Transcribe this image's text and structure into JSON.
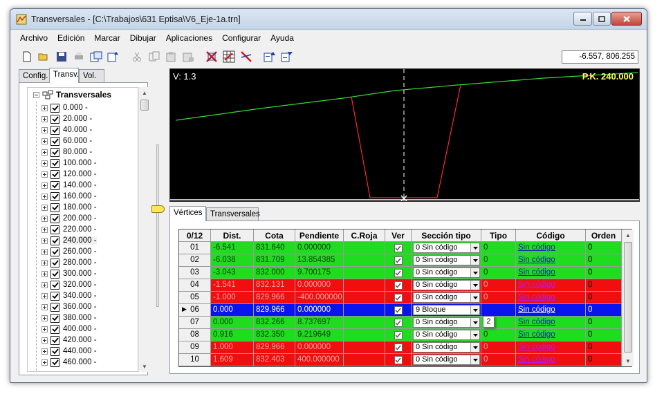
{
  "window": {
    "title": "Transversales - [C:\\Trabajos\\631 Eptisa\\V6_Eje-1a.trn]"
  },
  "menu": [
    "Archivo",
    "Edición",
    "Marcar",
    "Dibujar",
    "Aplicaciones",
    "Configurar",
    "Ayuda"
  ],
  "toolbar": {
    "icons": [
      "new-file-icon",
      "open-folder-icon",
      "save-icon",
      "print-icon",
      "copy-section-icon",
      "paste-section-icon",
      "cut-icon",
      "copy-icon",
      "paste-icon",
      "paste-special-icon",
      "delete-sections-icon",
      "grid-section-icon",
      "no-section-icon",
      "export-icon",
      "import-icon"
    ],
    "coordinates": "-6.557, 806.255"
  },
  "left_tabs": [
    "Config.",
    "Transv.",
    "Vol."
  ],
  "left_tabs_active": 1,
  "tree": {
    "root": "Transversales",
    "items": [
      "0.000 -",
      "20.000 -",
      "40.000 -",
      "60.000 -",
      "80.000 -",
      "100.000 -",
      "120.000 -",
      "140.000 -",
      "160.000 -",
      "180.000 -",
      "200.000 -",
      "220.000 -",
      "240.000 -",
      "260.000 -",
      "280.000 -",
      "300.000 -",
      "320.000 -",
      "340.000 -",
      "360.000 -",
      "380.000 -",
      "400.000 -",
      "420.000 -",
      "440.000 -",
      "460.000 -"
    ],
    "selected_index": 12
  },
  "canvas": {
    "v_label": "V: 1.3",
    "pk_label": "P.K. 240.000",
    "colors": {
      "background": "#000000",
      "terrain": "#33dd33",
      "section": "#ff2a2a",
      "axis": "#ffffff",
      "pk_text": "#ffff66"
    }
  },
  "bottom_tabs": [
    "Vértices",
    "Transversales"
  ],
  "bottom_tabs_active": 0,
  "grid": {
    "corner": "0/12",
    "columns": [
      "Dist.",
      "Cota",
      "Pendiente",
      "C.Roja",
      "Ver",
      "Sección tipo",
      "Tipo",
      "Código",
      "Orden"
    ],
    "rows": [
      {
        "id": "01",
        "dist": "-6.541",
        "cota": "831.640",
        "pendiente": "0.000000",
        "croja": "",
        "seccion": "0  Sin código",
        "tipo": "0",
        "codigo": "Sin código",
        "orden": "0",
        "status": "green"
      },
      {
        "id": "02",
        "dist": "-6.038",
        "cota": "831.709",
        "pendiente": "13.854385",
        "croja": "",
        "seccion": "0  Sin código",
        "tipo": "0",
        "codigo": "Sin código",
        "orden": "0",
        "status": "green"
      },
      {
        "id": "03",
        "dist": "-3.043",
        "cota": "832.000",
        "pendiente": "9.700175",
        "croja": "",
        "seccion": "0  Sin código",
        "tipo": "0",
        "codigo": "Sin código",
        "orden": "0",
        "status": "green"
      },
      {
        "id": "04",
        "dist": "-1.541",
        "cota": "832.131",
        "pendiente": "0.000000",
        "croja": "",
        "seccion": "0  Sin código",
        "tipo": "0",
        "codigo": "Sin código",
        "orden": "0",
        "status": "red"
      },
      {
        "id": "05",
        "dist": "-1.000",
        "cota": "829.966",
        "pendiente": "-400.000000",
        "croja": "",
        "seccion": "0  Sin código",
        "tipo": "0",
        "codigo": "Sin código",
        "orden": "0",
        "status": "red"
      },
      {
        "id": "06",
        "dist": "0.000",
        "cota": "829.966",
        "pendiente": "0.000000",
        "croja": "",
        "seccion": "9  Bloque",
        "tipo": "",
        "codigo": "Sin código",
        "orden": "0",
        "status": "selected"
      },
      {
        "id": "07",
        "dist": "0.000",
        "cota": "832.266",
        "pendiente": "8.737697",
        "croja": "",
        "seccion": "0  Sin código",
        "tipo": "0",
        "codigo": "Sin código",
        "orden": "0",
        "status": "green"
      },
      {
        "id": "08",
        "dist": "0.916",
        "cota": "832.350",
        "pendiente": "9.219649",
        "croja": "",
        "seccion": "0  Sin código",
        "tipo": "0",
        "codigo": "Sin código",
        "orden": "0",
        "status": "green"
      },
      {
        "id": "09",
        "dist": "1.000",
        "cota": "829.966",
        "pendiente": "0.000000",
        "croja": "",
        "seccion": "0  Sin código",
        "tipo": "0",
        "codigo": "Sin código",
        "orden": "0",
        "status": "red"
      },
      {
        "id": "10",
        "dist": "1.609",
        "cota": "832.403",
        "pendiente": "400.000000",
        "croja": "",
        "seccion": "0  Sin código",
        "tipo": "0",
        "codigo": "Sin código",
        "orden": "0",
        "status": "red"
      }
    ],
    "tooltip": "2",
    "colors": {
      "green": "#1edc1e",
      "red": "#f00e0e",
      "selected": "#0a14ee"
    }
  }
}
